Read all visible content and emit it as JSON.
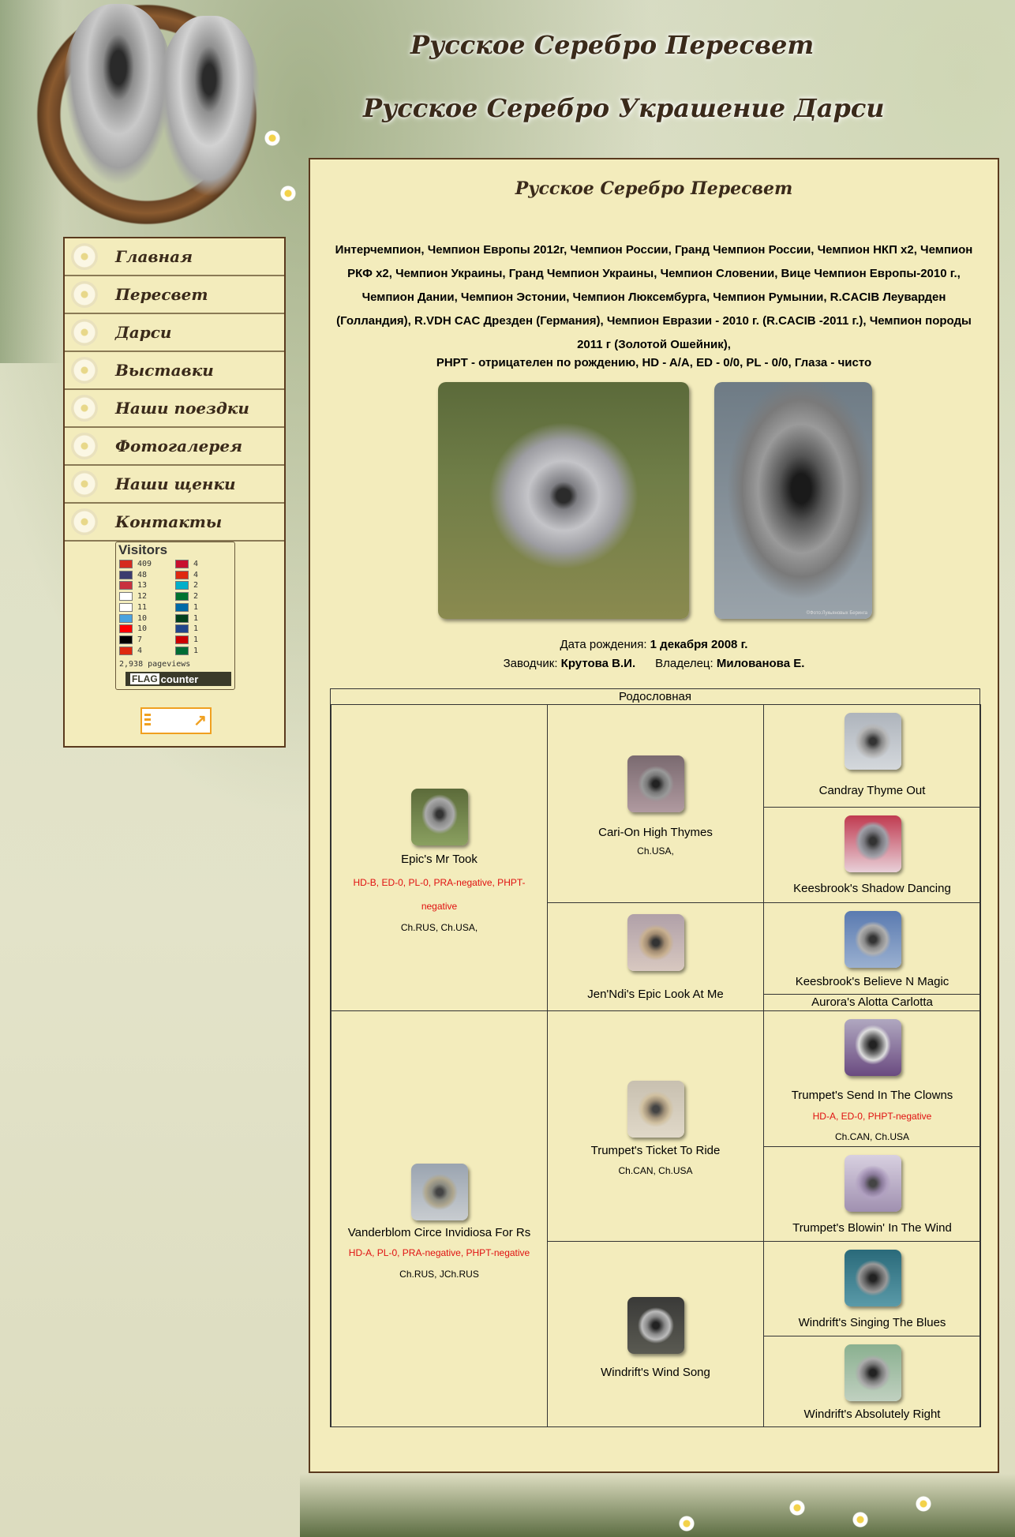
{
  "header": {
    "title": "Русское Серебро Пересвет",
    "subtitle": "Русское Серебро Украшение Дарси"
  },
  "nav": {
    "items": [
      {
        "label": "Главная"
      },
      {
        "label": "Пересвет"
      },
      {
        "label": "Дарси"
      },
      {
        "label": "Выставки"
      },
      {
        "label": "Наши поездки"
      },
      {
        "label": "Фотогалерея"
      },
      {
        "label": "Наши щенки"
      },
      {
        "label": "Контакты"
      }
    ]
  },
  "counter": {
    "title": "Visitors",
    "rows": [
      {
        "left": "409",
        "right": "4",
        "flag_left": "#d52b1e",
        "flag_right": "#c8102e"
      },
      {
        "left": "48",
        "right": "4",
        "flag_left": "#3c3b6e",
        "flag_right": "#de2910"
      },
      {
        "left": "13",
        "right": "2",
        "flag_left": "#c8313e",
        "flag_right": "#00afca"
      },
      {
        "left": "12",
        "right": "2",
        "flag_left": "#ffffff",
        "flag_right": "#00732f"
      },
      {
        "left": "11",
        "right": "1",
        "flag_left": "#ffffff",
        "flag_right": "#006aa7"
      },
      {
        "left": "10",
        "right": "1",
        "flag_left": "#4aa3df",
        "flag_right": "#01411c"
      },
      {
        "left": "10",
        "right": "1",
        "flag_left": "#ff0000",
        "flag_right": "#21468b"
      },
      {
        "left": "7",
        "right": "1",
        "flag_left": "#000000",
        "flag_right": "#cc0001"
      },
      {
        "left": "4",
        "right": "1",
        "flag_left": "#de2910",
        "flag_right": "#006c35"
      }
    ],
    "pageviews": "2,938 pageviews",
    "brand_flag": "FLAG",
    "brand_counter": "counter"
  },
  "main": {
    "title": "Русское Серебро Пересвет",
    "titles": "Интерчемпион, Чемпион Европы 2012г, Чемпион России, Гранд Чемпион России, Чемпион НКП х2, Чемпион РКФ х2, Чемпион Украины, Гранд Чемпион Украины, Чемпион Словении, Вице Чемпион Европы-2010 г., Чемпион Дании, Чемпион Эстонии, Чемпион Люксембурга, Чемпион Румынии, R.CACIB Леуварден (Голландия), R.VDH CAC Дрезден (Германия), Чемпион Евразии - 2010 г. (R.CACIB -2011 г.), Чемпион породы 2011 г (Золотой Ошейник),",
    "health": "PHPT - отрицателен по рождению, HD - A/A, ED - 0/0, PL - 0/0, Глаза - чисто",
    "photo_watermark": "©Фото:Лукьяновых Беринга",
    "birth_label": "Дата рождения:",
    "birth_value": "1 декабря 2008 г.",
    "breeder_label": "Заводчик:",
    "breeder_value": "Крутова В.И.",
    "owner_label": "Владелец:",
    "owner_value": "Милованова Е."
  },
  "pedigree": {
    "caption": "Родословная",
    "sire": {
      "name": "Epic's Mr Took",
      "health": "HD-B, ED-0, PL-0, PRA-negative, PHPT-negative",
      "titles": "Ch.RUS, Ch.USA,"
    },
    "sire_sire": {
      "name": "Cari-On High Thymes",
      "titles": "Ch.USA,"
    },
    "sire_dam": {
      "name": "Jen'Ndi's Epic Look At Me"
    },
    "sss": {
      "name": "Candray Thyme Out"
    },
    "ssd": {
      "name": "Keesbrook's Shadow Dancing"
    },
    "sds": {
      "name": "Keesbrook's Believe N Magic"
    },
    "sdd": {
      "name": "Aurora's Alotta Carlotta"
    },
    "dam": {
      "name": "Vanderblom Circe Invidiosa For Rs",
      "health": "HD-A, PL-0, PRA-negative, PHPT-negative",
      "titles": "Ch.RUS, JCh.RUS"
    },
    "dam_sire": {
      "name": "Trumpet's Ticket To Ride",
      "titles": "Ch.CAN, Ch.USA"
    },
    "dam_dam": {
      "name": "Windrift's Wind Song"
    },
    "dss": {
      "name": "Trumpet's Send In The Clowns",
      "health": "HD-A, ED-0, PHPT-negative",
      "titles": "Ch.CAN, Ch.USA"
    },
    "dsd": {
      "name": "Trumpet's Blowin' In The Wind"
    },
    "dds": {
      "name": "Windrift's Singing The Blues"
    },
    "ddd": {
      "name": "Windrift's Absolutely Right"
    }
  },
  "colors": {
    "panel_bg": "#f3ecbc",
    "border": "#5a3a1e",
    "health_red": "#e01010",
    "accent_orange": "#f0a020"
  }
}
